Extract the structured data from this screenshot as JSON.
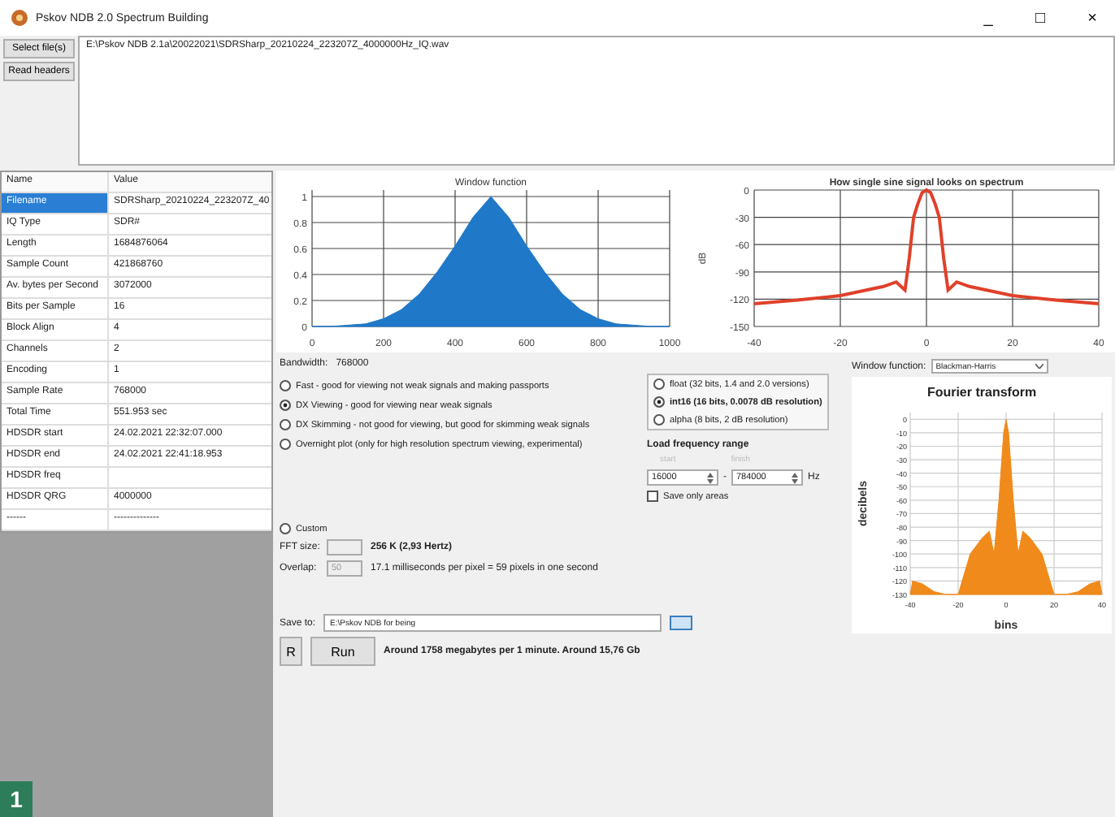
{
  "window": {
    "title": "Pskov NDB 2.0 Spectrum Building",
    "controls": [
      "_",
      "□",
      "×"
    ]
  },
  "toolbar": {
    "buttons": [
      "Select file(s)",
      "Read headers"
    ],
    "path": "E:\\Pskov NDB 2.1a\\20022021\\SDRSharp_20210224_223207Z_4000000Hz_IQ.wav"
  },
  "properties": {
    "columns": [
      "Name",
      "Value"
    ],
    "rows": [
      {
        "name": "Filename",
        "value": "SDRSharp_20210224_223207Z_40",
        "selected": true
      },
      {
        "name": "IQ Type",
        "value": "SDR#",
        "selected": false
      },
      {
        "name": "Length",
        "value": "1684876064",
        "selected": false
      },
      {
        "name": "Sample Count",
        "value": "421868760",
        "selected": false
      },
      {
        "name": "Av. bytes per Second",
        "value": "3072000",
        "selected": false
      },
      {
        "name": "Bits per Sample",
        "value": "16",
        "selected": false
      },
      {
        "name": "Block Align",
        "value": "4",
        "selected": false
      },
      {
        "name": "Channels",
        "value": "2",
        "selected": false
      },
      {
        "name": "Encoding",
        "value": "1",
        "selected": false
      },
      {
        "name": "Sample Rate",
        "value": "768000",
        "selected": false
      },
      {
        "name": "Total Time",
        "value": "551.953 sec",
        "selected": false
      },
      {
        "name": "HDSDR start",
        "value": "24.02.2021 22:32:07.000",
        "selected": false
      },
      {
        "name": "HDSDR end",
        "value": "24.02.2021 22:41:18.953",
        "selected": false
      },
      {
        "name": "HDSDR freq",
        "selected": false
      },
      {
        "name": "HDSDR QRG",
        "value": "4000000",
        "selected": false
      },
      {
        "name": "------",
        "value": "--------------",
        "selected": false
      }
    ]
  },
  "charts": [
    {
      "chart_data": {
        "type": "area",
        "title": "Window function",
        "x": [
          0,
          50,
          100,
          150,
          200,
          250,
          300,
          350,
          400,
          450,
          500,
          550,
          600,
          650,
          700,
          750,
          800,
          850,
          900,
          950,
          1000
        ],
        "series": [
          {
            "color": "#1f78c8",
            "values": [
              0,
              0,
              0.01,
              0.02,
              0.06,
              0.13,
              0.25,
              0.42,
              0.62,
              0.84,
              1,
              0.84,
              0.62,
              0.42,
              0.25,
              0.13,
              0.06,
              0.02,
              0.01,
              0,
              0
            ]
          }
        ],
        "grid": true,
        "xlim": [
          0,
          1000
        ],
        "ylim": [
          0,
          1.05
        ],
        "xticks": [
          0,
          200,
          400,
          600,
          800,
          1000
        ],
        "yticks": [
          0,
          0.2,
          0.4,
          0.6,
          0.8,
          1
        ]
      }
    },
    {
      "chart_data": {
        "type": "line",
        "title": "How single sine signal looks on spectrum",
        "ylabel": "dB",
        "x": [
          -40,
          -30,
          -20,
          -10,
          -7,
          -5,
          -4,
          -3,
          -2,
          -1,
          0,
          1,
          2,
          3,
          4,
          5,
          7,
          10,
          20,
          30,
          40
        ],
        "grid": true,
        "series": [
          {
            "color": "#e0402a",
            "values": [
              -125,
              -121,
              -116,
              -106,
              -101,
              -110,
              -75,
              -30,
              -15,
              -3,
              0,
              -3,
              -15,
              -30,
              -75,
              -110,
              -101,
              -106,
              -116,
              -121,
              -125
            ]
          }
        ],
        "xlim": [
          -40,
          40
        ],
        "ylim": [
          -150,
          0
        ],
        "xticks": [
          -40,
          -20,
          0,
          20,
          40
        ],
        "yticks": [
          0,
          -30,
          -60,
          -90,
          -120,
          -150
        ]
      }
    }
  ],
  "settings": {
    "bandwidth_label": "Bandwidth:",
    "bandwidth": "768000",
    "modes": [
      {
        "label": "Fast - good for viewing not weak signals and making passports",
        "selected": false
      },
      {
        "label": "DX Viewing - good for viewing near weak signals",
        "selected": true
      },
      {
        "label": "DX Skimming - not good for viewing, but good for skimming weak signals",
        "selected": false
      },
      {
        "label": "Overnight plot (only for high resolution spectrum viewing, experimental)",
        "selected": false
      }
    ],
    "custom": {
      "label": "Custom",
      "selected": false
    },
    "fft_size_label": "FFT size:",
    "fft_size": "256 K (2,93 Hertz)",
    "overlap_label": "Overlap:",
    "overlap": "50",
    "overlap_info": "17.1 milliseconds per pixel = 59 pixels in one second",
    "formats": [
      {
        "label": "float (32 bits, 1.4 and 2.0 versions)",
        "selected": false
      },
      {
        "label": "int16 (16 bits, 0.0078 dB resolution)",
        "selected": true
      },
      {
        "label": "alpha (8 bits, 2 dB resolution)",
        "selected": false
      }
    ],
    "range": {
      "title": "Load frequency range",
      "start_label": "start",
      "start": "16000",
      "separator": "-",
      "end_label": "finish",
      "end": "784000",
      "unit": "Hz"
    },
    "save_only_areas": {
      "label": "Save only areas",
      "checked": false
    },
    "window_function": {
      "label": "Window function:",
      "value": "Blackman-Harris"
    },
    "save_to": {
      "label": "Save to:",
      "value": "E:\\Pskov NDB for being"
    },
    "run": {
      "r_label": "R",
      "label": "Run",
      "estimate": "Around 1758 megabytes per 1 minute. Around 15,76 Gb"
    }
  },
  "fourier": {
    "chart_data": {
      "type": "area",
      "title": "Fourier transform",
      "xlabel": "bins",
      "ylabel": "decibels",
      "x": [
        -40,
        -39,
        -35,
        -30,
        -25,
        -20,
        -15,
        -10,
        -7,
        -5,
        -3,
        -1,
        0,
        1,
        3,
        5,
        7,
        10,
        15,
        20,
        25,
        30,
        35,
        39,
        40
      ],
      "grid": true,
      "series": [
        {
          "color": "#f08a1a",
          "values": [
            -130,
            -120,
            -122,
            -128,
            -130,
            -130,
            -100,
            -88,
            -83,
            -100,
            -60,
            -10,
            0,
            -10,
            -60,
            -100,
            -83,
            -88,
            -100,
            -130,
            -130,
            -128,
            -122,
            -120,
            -130
          ]
        }
      ],
      "xlim": [
        -40,
        40
      ],
      "ylim": [
        -130,
        5
      ],
      "xticks": [
        -40,
        -20,
        0,
        20,
        40
      ],
      "yticks": [
        0,
        -10,
        -20,
        -30,
        -40,
        -50,
        -60,
        -70,
        -80,
        -90,
        -100,
        -110,
        -120,
        -130
      ]
    }
  },
  "figure_badge": "1"
}
